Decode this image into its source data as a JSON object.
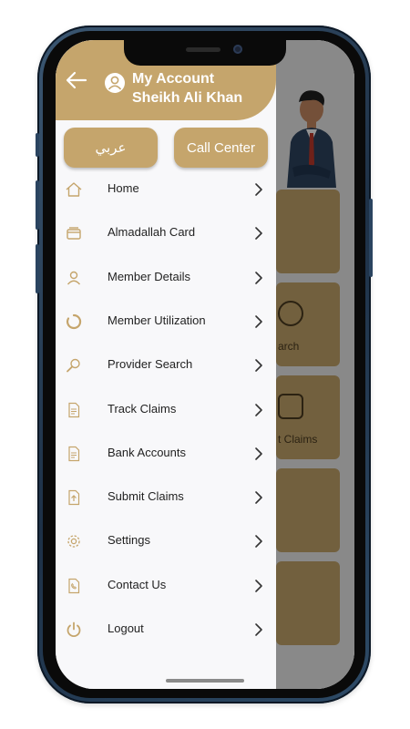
{
  "header": {
    "title": "My Account",
    "user_name": "Sheikh Ali Khan"
  },
  "buttons": {
    "language": "عربي",
    "call_center": "Call Center"
  },
  "menu": [
    {
      "label": "Home",
      "icon": "home-icon"
    },
    {
      "label": "Almadallah Card",
      "icon": "card-icon"
    },
    {
      "label": "Member Details",
      "icon": "user-icon"
    },
    {
      "label": "Member Utilization",
      "icon": "utilization-icon"
    },
    {
      "label": "Provider Search",
      "icon": "search-icon"
    },
    {
      "label": "Track Claims",
      "icon": "document-icon"
    },
    {
      "label": "Bank Accounts",
      "icon": "document-icon"
    },
    {
      "label": "Submit Claims",
      "icon": "upload-document-icon"
    },
    {
      "label": "Settings",
      "icon": "gear-icon"
    },
    {
      "label": "Contact Us",
      "icon": "contact-document-icon"
    },
    {
      "label": "Logout",
      "icon": "power-icon"
    }
  ],
  "background": {
    "tile_search": "arch",
    "tile_claims": "t Claims"
  },
  "colors": {
    "accent": "#c5a56c",
    "drawer_bg": "#f8f8fa",
    "text": "#222222"
  }
}
